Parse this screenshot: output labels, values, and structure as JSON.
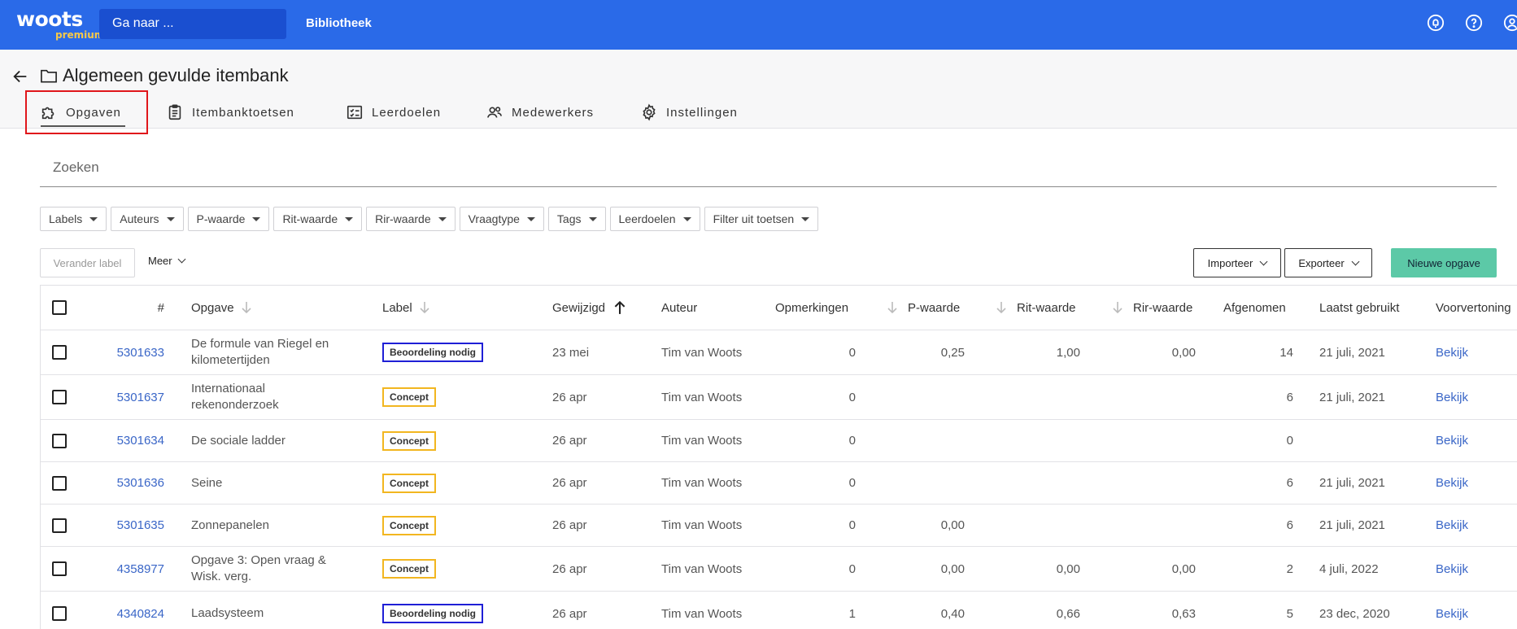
{
  "app": {
    "logo_main": "woots",
    "logo_sub": "premium",
    "goto_label": "Ga naar ...",
    "nav_library": "Bibliotheek"
  },
  "header": {
    "title": "Algemeen gevulde itembank",
    "tabs": [
      {
        "label": "Opgaven",
        "icon": "puzzle-icon"
      },
      {
        "label": "Itembanktoetsen",
        "icon": "clipboard-icon"
      },
      {
        "label": "Leerdoelen",
        "icon": "checklist-icon"
      },
      {
        "label": "Medewerkers",
        "icon": "people-icon"
      },
      {
        "label": "Instellingen",
        "icon": "gear-icon"
      }
    ]
  },
  "search": {
    "placeholder": "Zoeken"
  },
  "filters": [
    "Labels",
    "Auteurs",
    "P-waarde",
    "Rit-waarde",
    "Rir-waarde",
    "Vraagtype",
    "Tags",
    "Leerdoelen",
    "Filter uit toetsen"
  ],
  "actions": {
    "change_label": "Verander label",
    "more": "Meer",
    "import": "Importeer",
    "export": "Exporteer",
    "new_item": "Nieuwe opgave"
  },
  "table": {
    "headers": {
      "id": "#",
      "opgave": "Opgave",
      "label": "Label",
      "gewijzigd": "Gewijzigd",
      "auteur": "Auteur",
      "opmerkingen": "Opmerkingen",
      "p": "P-waarde",
      "rit": "Rit-waarde",
      "rir": "Rir-waarde",
      "afgenomen": "Afgenomen",
      "laatst": "Laatst gebruikt",
      "voorvertoning": "Voorvertoning"
    },
    "rows": [
      {
        "id": "5301633",
        "opgave": "De formule van Riegel en kilometertijden",
        "label": "Beoordeling nodig",
        "label_color": "#1f1fd6",
        "gewijzigd": "23 mei",
        "auteur": "Tim van Woots",
        "opmerkingen": "0",
        "p": "0,25",
        "rit": "1,00",
        "rir": "0,00",
        "afgenomen": "14",
        "laatst": "21 juli, 2021",
        "preview": "Bekijk"
      },
      {
        "id": "5301637",
        "opgave": "Internationaal rekenonderzoek",
        "label": "Concept",
        "label_color": "#f2b620",
        "gewijzigd": "26 apr",
        "auteur": "Tim van Woots",
        "opmerkingen": "0",
        "p": "",
        "rit": "",
        "rir": "",
        "afgenomen": "6",
        "laatst": "21 juli, 2021",
        "preview": "Bekijk"
      },
      {
        "id": "5301634",
        "opgave": "De sociale ladder",
        "label": "Concept",
        "label_color": "#f2b620",
        "gewijzigd": "26 apr",
        "auteur": "Tim van Woots",
        "opmerkingen": "0",
        "p": "",
        "rit": "",
        "rir": "",
        "afgenomen": "0",
        "laatst": "",
        "preview": "Bekijk"
      },
      {
        "id": "5301636",
        "opgave": "Seine",
        "label": "Concept",
        "label_color": "#f2b620",
        "gewijzigd": "26 apr",
        "auteur": "Tim van Woots",
        "opmerkingen": "0",
        "p": "",
        "rit": "",
        "rir": "",
        "afgenomen": "6",
        "laatst": "21 juli, 2021",
        "preview": "Bekijk"
      },
      {
        "id": "5301635",
        "opgave": "Zonnepanelen",
        "label": "Concept",
        "label_color": "#f2b620",
        "gewijzigd": "26 apr",
        "auteur": "Tim van Woots",
        "opmerkingen": "0",
        "p": "0,00",
        "rit": "",
        "rir": "",
        "afgenomen": "6",
        "laatst": "21 juli, 2021",
        "preview": "Bekijk"
      },
      {
        "id": "4358977",
        "opgave": "Opgave 3: Open vraag & Wisk. verg.",
        "label": "Concept",
        "label_color": "#f2b620",
        "gewijzigd": "26 apr",
        "auteur": "Tim van Woots",
        "opmerkingen": "0",
        "p": "0,00",
        "rit": "0,00",
        "rir": "0,00",
        "afgenomen": "2",
        "laatst": "4 juli, 2022",
        "preview": "Bekijk"
      },
      {
        "id": "4340824",
        "opgave": "Laadsysteem",
        "label": "Beoordeling nodig",
        "label_color": "#1f1fd6",
        "gewijzigd": "26 apr",
        "auteur": "Tim van Woots",
        "opmerkingen": "1",
        "p": "0,40",
        "rit": "0,66",
        "rir": "0,63",
        "afgenomen": "5",
        "laatst": "23 dec, 2020",
        "preview": "Bekijk"
      }
    ]
  },
  "colors": {
    "topbar": "#2a6ae8",
    "accent_new": "#5cc9a7",
    "link": "#3a66c7",
    "highlight": "#e0161b"
  }
}
